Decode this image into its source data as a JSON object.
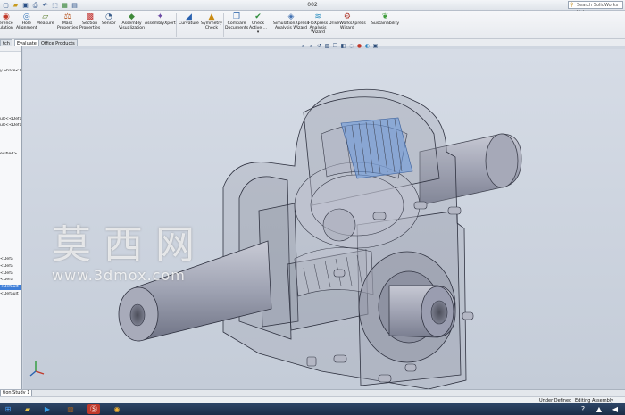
{
  "window": {
    "title": "002"
  },
  "help_search": {
    "placeholder": "Search SolidWorks Help"
  },
  "ribbon": [
    {
      "label1": "erence",
      "label2": "ulation",
      "icon": "interference-icon",
      "color": "#c23a2b"
    },
    {
      "label1": "Hole",
      "label2": "Alignment",
      "icon": "hole-alignment-icon",
      "color": "#2b6fb6"
    },
    {
      "label1": "Measure",
      "label2": "",
      "icon": "measure-icon",
      "color": "#5a7d2b"
    },
    {
      "label1": "Mass",
      "label2": "Properties",
      "icon": "mass-properties-icon",
      "color": "#b5521c"
    },
    {
      "label1": "Section",
      "label2": "Properties",
      "icon": "section-properties-icon",
      "color": "#c2322f"
    },
    {
      "label1": "Sensor",
      "label2": "",
      "icon": "sensor-icon",
      "color": "#3c5f8c"
    },
    {
      "label1": "Assembly",
      "label2": "Visualization",
      "icon": "assembly-visualization-icon",
      "color": "#3f8a3a"
    },
    {
      "label1": "AssemblyXpert",
      "label2": "",
      "icon": "assemblyxpert-icon",
      "color": "#6b4aa3"
    },
    {
      "label1": "Curvature",
      "label2": "",
      "icon": "curvature-icon",
      "color": "#2a62b0"
    },
    {
      "label1": "Symmetry",
      "label2": "Check",
      "icon": "symmetry-check-icon",
      "color": "#c98a12"
    },
    {
      "label1": "Compare",
      "label2": "Documents",
      "icon": "compare-documents-icon",
      "color": "#3b6fb0"
    },
    {
      "label1": "Check",
      "label2": "Active ...",
      "icon": "check-active-icon",
      "color": "#2f8d3c"
    },
    {
      "label1": "SimulationXpress",
      "label2": "Analysis Wizard",
      "icon": "simulationxpress-icon",
      "color": "#3f6fb1"
    },
    {
      "label1": "FloXpress",
      "label2": "Analysis",
      "label3": "Wizard",
      "icon": "floxpress-icon",
      "color": "#2d8fc0"
    },
    {
      "label1": "DriveWorksXpress",
      "label2": "Wizard",
      "icon": "driveworksxpress-icon",
      "color": "#b03a2e"
    },
    {
      "label1": "Sustainability",
      "label2": "",
      "icon": "sustainability-icon",
      "color": "#3e9d3a"
    }
  ],
  "tabs": {
    "t1": "tch",
    "t2": "Evaluate",
    "t3": "Office Products"
  },
  "tree": [
    "y Share<1>",
    "ult<<Defa",
    "ult<<Defa",
    "ecified>",
    "<Defa",
    "<Defa",
    "<Defa",
    "<Defa",
    "<Default",
    "<Default"
  ],
  "watermark": {
    "cn": "莫西网",
    "url": "www.3dmox.com"
  },
  "bottom_tabs": {
    "study": "tion Study 1"
  },
  "status": {
    "state": "Under Defined",
    "mode": "Editing Assembly"
  }
}
